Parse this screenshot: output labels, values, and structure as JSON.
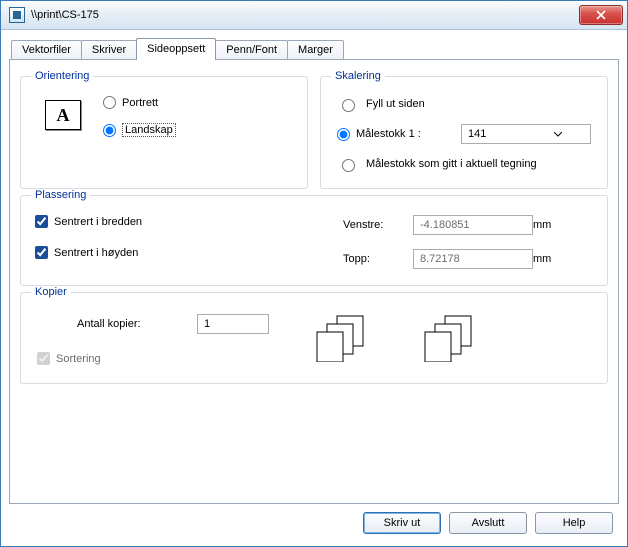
{
  "window": {
    "title": "\\\\print\\CS-175"
  },
  "tabs": [
    "Vektorfiler",
    "Skriver",
    "Sideoppsett",
    "Penn/Font",
    "Marger"
  ],
  "active_tab": 2,
  "orientation": {
    "legend": "Orientering",
    "thumb_glyph": "A",
    "options": {
      "portrait": "Portrett",
      "landscape": "Landskap"
    },
    "selected": "landscape"
  },
  "scaling": {
    "legend": "Skalering",
    "options": {
      "fit": "Fyll ut siden",
      "scale1": "Målestokk 1 :",
      "drawing": "Målestokk som gitt i aktuell tegning"
    },
    "selected": "scale1",
    "scale1_value": "141"
  },
  "placement": {
    "legend": "Plassering",
    "center_h_label": "Sentrert i bredden",
    "center_v_label": "Sentrert i høyden",
    "center_h": true,
    "center_v": true,
    "left_label": "Venstre:",
    "top_label": "Topp:",
    "left_value": "-4.180851",
    "top_value": "8.72178",
    "unit": "mm"
  },
  "copies": {
    "legend": "Kopier",
    "count_label": "Antall kopier:",
    "count_value": "1",
    "collate_label": "Sortering",
    "collate_checked": true,
    "collate_enabled": false
  },
  "buttons": {
    "print": "Skriv ut",
    "close": "Avslutt",
    "help": "Help"
  }
}
